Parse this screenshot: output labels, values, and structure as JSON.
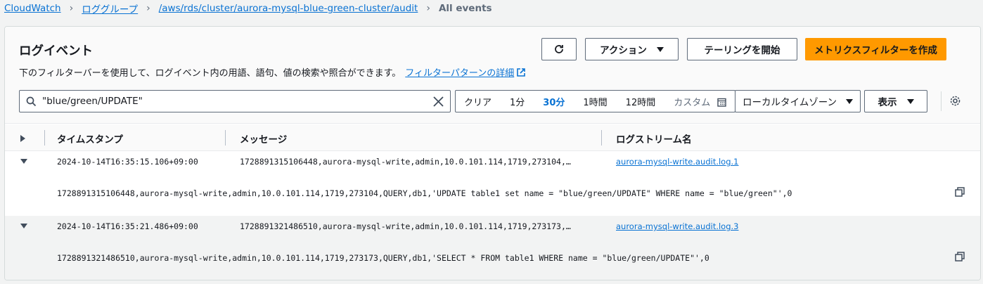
{
  "breadcrumb": {
    "items": [
      "CloudWatch",
      "ロググループ",
      "/aws/rds/cluster/aurora-mysql-blue-green-cluster/audit"
    ],
    "current": "All events"
  },
  "header": {
    "title": "ログイベント",
    "description": "下のフィルターバーを使用して、ログイベント内の用語、語句、値の検索や照合ができます。",
    "link": "フィルターパターンの詳細"
  },
  "toolbar": {
    "actions_label": "アクション",
    "tail_label": "テーリングを開始",
    "metric_filter_label": "メトリクスフィルターを作成"
  },
  "search": {
    "value": "\"blue/green/UPDATE\""
  },
  "time_range": {
    "clear": "クリア",
    "options": [
      "1分",
      "30分",
      "1時間",
      "12時間"
    ],
    "selected": "30分",
    "custom": "カスタム"
  },
  "timezone": "ローカルタイムゾーン",
  "display_label": "表示",
  "table": {
    "headers": {
      "timestamp": "タイムスタンプ",
      "message": "メッセージ",
      "stream": "ログストリーム名"
    },
    "rows": [
      {
        "timestamp": "2024-10-14T16:35:15.106+09:00",
        "message": "1728891315106448,aurora-mysql-write,admin,10.0.101.114,1719,273104,…",
        "stream": "aurora-mysql-write.audit.log.1",
        "detail": "1728891315106448,aurora-mysql-write,admin,10.0.101.114,1719,273104,QUERY,db1,'UPDATE table1 set name = \"blue/green/UPDATE\" WHERE name = \"blue/green\"',0"
      },
      {
        "timestamp": "2024-10-14T16:35:21.486+09:00",
        "message": "1728891321486510,aurora-mysql-write,admin,10.0.101.114,1719,273173,…",
        "stream": "aurora-mysql-write.audit.log.3",
        "detail": "1728891321486510,aurora-mysql-write,admin,10.0.101.114,1719,273173,QUERY,db1,'SELECT * FROM table1 WHERE name = \"blue/green/UPDATE\"',0"
      }
    ]
  },
  "colors": {
    "link": "#0972d3",
    "primary": "#ff9900",
    "selected": "#0972d3"
  }
}
